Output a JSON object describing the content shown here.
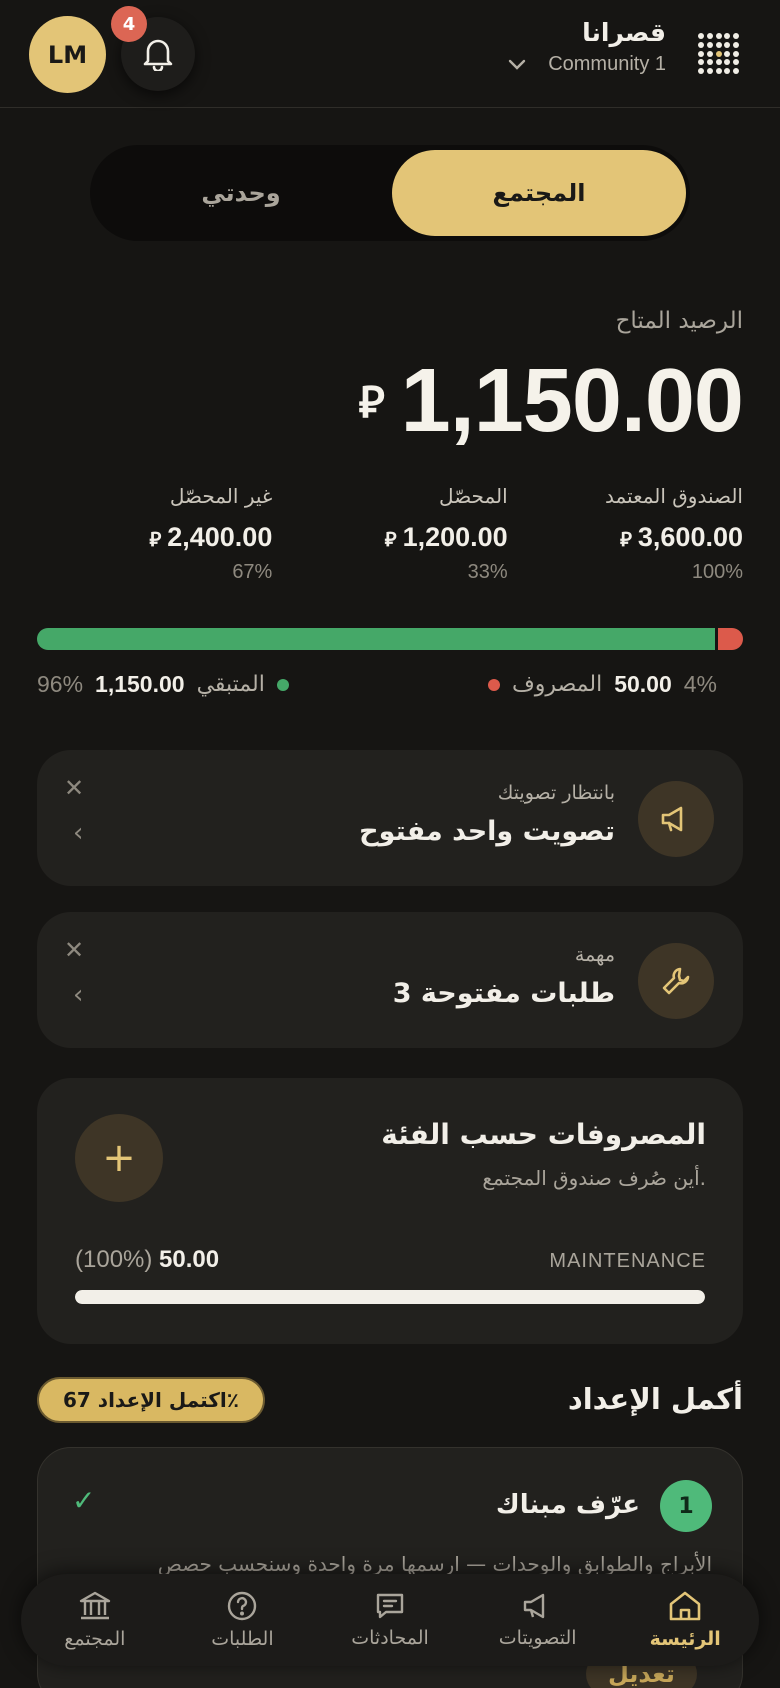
{
  "header": {
    "avatar_initials": "LM",
    "notification_count": "4",
    "brand_name": "قصرانا",
    "community": "Community 1"
  },
  "segments": {
    "active": "المجتمع",
    "inactive": "وحدتي"
  },
  "balance": {
    "label": "الرصيد المتاح",
    "amount": "1,150.00",
    "currency_symbol": "⃁"
  },
  "stats": [
    {
      "title": "الصندوق المعتمد",
      "value": "3,600.00",
      "percent": "100%"
    },
    {
      "title": "المحصّل",
      "value": "1,200.00",
      "percent": "33%"
    },
    {
      "title": "غير المحصّل",
      "value": "2,400.00",
      "percent": "67%"
    }
  ],
  "progress": {
    "spent_fraction": 0.04,
    "remaining_fraction": 0.96,
    "spent_label": "المصروف",
    "spent_value": "50.00",
    "spent_percent": "4%",
    "remaining_label": "المتبقي",
    "remaining_value": "1,150.00",
    "remaining_percent": "96%",
    "spent_color": "#dc5a4b",
    "remaining_color": "#45a868"
  },
  "notices": [
    {
      "subtitle": "بانتظار تصويتك",
      "title": "تصويت واحد مفتوح",
      "icon": "megaphone-icon"
    },
    {
      "subtitle": "مهمة",
      "title": "3 طلبات مفتوحة",
      "icon": "wrench-icon"
    }
  ],
  "expenses": {
    "title": "المصروفات حسب الفئة",
    "subtitle": "أين صُرف صندوق المجتمع.",
    "category": "MAINTENANCE",
    "amount": "50.00",
    "percent_text": "(100%)",
    "fraction": 1.0
  },
  "setup": {
    "title": "أكمل الإعداد",
    "progress_pill": "اكتمل الإعداد 67٪",
    "step": {
      "number": "1",
      "title": "عرّف مبناك",
      "description": "الأبراج والطوابق والوحدات — ارسمها مرة واحدة وسنحسب حصص",
      "edit_label": "تعديل"
    }
  },
  "nav": [
    {
      "label": "الرئيسة",
      "icon": "home-icon",
      "active": true
    },
    {
      "label": "التصويتات",
      "icon": "megaphone-icon",
      "active": false
    },
    {
      "label": "المحادثات",
      "icon": "chat-icon",
      "active": false
    },
    {
      "label": "الطلبات",
      "icon": "help-icon",
      "active": false
    },
    {
      "label": "المجتمع",
      "icon": "bank-icon",
      "active": false
    }
  ],
  "colors": {
    "accent": "#e3c577",
    "background": "#161513",
    "card": "#22211e"
  }
}
